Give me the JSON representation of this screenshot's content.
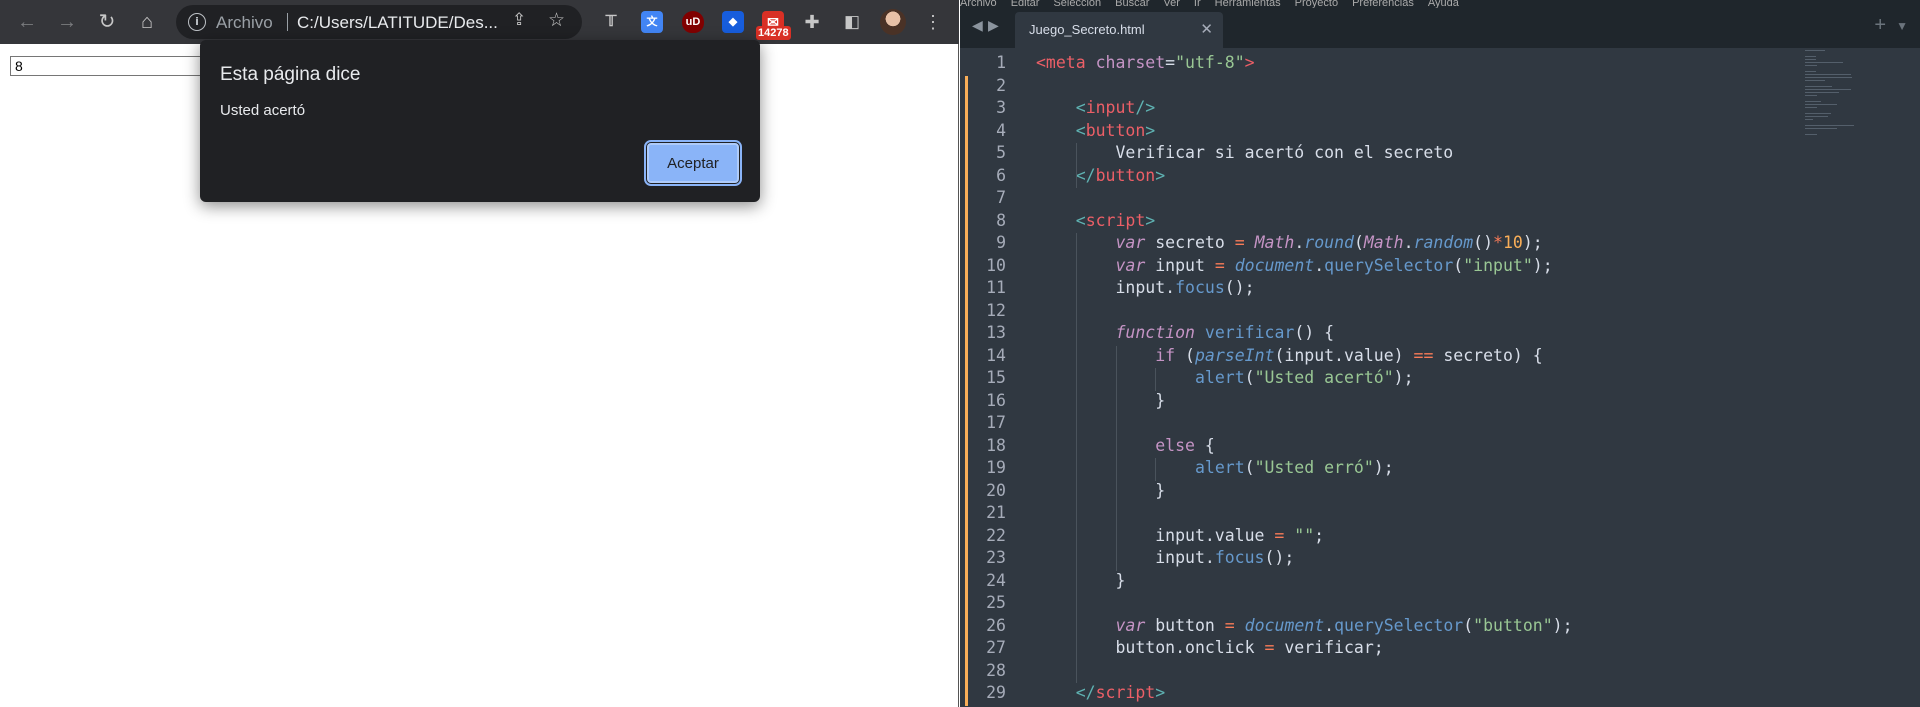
{
  "browser": {
    "omnibox": {
      "scheme_label": "Archivo",
      "url": "C:/Users/LATITUDE/Des..."
    },
    "extensions": [
      {
        "name": "translate-extension-icon",
        "glyph": "文"
      },
      {
        "name": "ublock-icon",
        "glyph": "uD"
      },
      {
        "name": "bitwarden-icon",
        "glyph": "◆"
      },
      {
        "name": "gmail-checker-icon",
        "glyph": "✉"
      }
    ],
    "mail_badge": "14278",
    "page": {
      "input_value": "8"
    },
    "alert": {
      "title": "Esta página dice",
      "message": "Usted acertó",
      "ok_label": "Aceptar"
    }
  },
  "editor": {
    "menu": [
      "Archivo",
      "Editar",
      "Selección",
      "Buscar",
      "Ver",
      "Ir",
      "Herramientas",
      "Proyecto",
      "Preferencias",
      "Ayuda"
    ],
    "tab_name": "Juego_Secreto.html",
    "modified_lines": [
      2,
      3,
      4,
      5,
      6,
      7,
      8,
      9,
      10,
      11,
      12,
      13,
      14,
      15,
      16,
      17,
      18,
      19,
      20,
      21,
      22,
      23,
      24,
      25,
      26,
      27,
      28,
      29
    ],
    "lines": [
      {
        "n": "1",
        "tokens": [
          [
            "t-tag",
            "<meta"
          ],
          [
            "t-plain",
            " "
          ],
          [
            "t-attr",
            "charset"
          ],
          [
            "t-plain",
            "="
          ],
          [
            "t-str",
            "\"utf-8\""
          ],
          [
            "t-tag",
            ">"
          ]
        ]
      },
      {
        "n": "2",
        "tokens": []
      },
      {
        "n": "3",
        "tokens": [
          [
            "t-plain",
            "    "
          ],
          [
            "t-punc",
            "<"
          ],
          [
            "t-tag",
            "input"
          ],
          [
            "t-punc",
            "/>"
          ]
        ]
      },
      {
        "n": "4",
        "tokens": [
          [
            "t-plain",
            "    "
          ],
          [
            "t-punc",
            "<"
          ],
          [
            "t-tag",
            "button"
          ],
          [
            "t-punc",
            ">"
          ]
        ]
      },
      {
        "n": "5",
        "tokens": [
          [
            "t-plain",
            "        Verificar si acertó con el secreto"
          ]
        ]
      },
      {
        "n": "6",
        "tokens": [
          [
            "t-plain",
            "    "
          ],
          [
            "t-punc",
            "</"
          ],
          [
            "t-tag",
            "button"
          ],
          [
            "t-punc",
            ">"
          ]
        ]
      },
      {
        "n": "7",
        "tokens": []
      },
      {
        "n": "8",
        "tokens": [
          [
            "t-plain",
            "    "
          ],
          [
            "t-punc",
            "<"
          ],
          [
            "t-tag",
            "script"
          ],
          [
            "t-punc",
            ">"
          ]
        ]
      },
      {
        "n": "9",
        "tokens": [
          [
            "t-plain",
            "        "
          ],
          [
            "t-kw",
            "var"
          ],
          [
            "t-plain",
            " secreto "
          ],
          [
            "t-op",
            "="
          ],
          [
            "t-plain",
            " "
          ],
          [
            "t-obj",
            "Math"
          ],
          [
            "t-plain",
            "."
          ],
          [
            "t-fni",
            "round"
          ],
          [
            "t-plain",
            "("
          ],
          [
            "t-obj",
            "Math"
          ],
          [
            "t-plain",
            "."
          ],
          [
            "t-fni",
            "random"
          ],
          [
            "t-plain",
            "()"
          ],
          [
            "t-op",
            "*"
          ],
          [
            "t-num",
            "10"
          ],
          [
            "t-plain",
            ");"
          ]
        ]
      },
      {
        "n": "10",
        "tokens": [
          [
            "t-plain",
            "        "
          ],
          [
            "t-kw",
            "var"
          ],
          [
            "t-plain",
            " input "
          ],
          [
            "t-op",
            "="
          ],
          [
            "t-plain",
            " "
          ],
          [
            "t-fni",
            "document"
          ],
          [
            "t-plain",
            "."
          ],
          [
            "t-fn",
            "querySelector"
          ],
          [
            "t-plain",
            "("
          ],
          [
            "t-str",
            "\"input\""
          ],
          [
            "t-plain",
            ");"
          ]
        ]
      },
      {
        "n": "11",
        "tokens": [
          [
            "t-plain",
            "        input."
          ],
          [
            "t-fn",
            "focus"
          ],
          [
            "t-plain",
            "();"
          ]
        ]
      },
      {
        "n": "12",
        "tokens": []
      },
      {
        "n": "13",
        "tokens": [
          [
            "t-plain",
            "        "
          ],
          [
            "t-kw",
            "function"
          ],
          [
            "t-plain",
            " "
          ],
          [
            "t-fn",
            "verificar"
          ],
          [
            "t-plain",
            "() {"
          ]
        ]
      },
      {
        "n": "14",
        "tokens": [
          [
            "t-plain",
            "            "
          ],
          [
            "t-kwn",
            "if"
          ],
          [
            "t-plain",
            " ("
          ],
          [
            "t-fni",
            "parseInt"
          ],
          [
            "t-plain",
            "(input.value) "
          ],
          [
            "t-op",
            "=="
          ],
          [
            "t-plain",
            " secreto) {"
          ]
        ]
      },
      {
        "n": "15",
        "tokens": [
          [
            "t-plain",
            "                "
          ],
          [
            "t-fn",
            "alert"
          ],
          [
            "t-plain",
            "("
          ],
          [
            "t-str",
            "\"Usted acertó\""
          ],
          [
            "t-plain",
            ");"
          ]
        ]
      },
      {
        "n": "16",
        "tokens": [
          [
            "t-plain",
            "            }"
          ]
        ]
      },
      {
        "n": "17",
        "tokens": []
      },
      {
        "n": "18",
        "tokens": [
          [
            "t-plain",
            "            "
          ],
          [
            "t-kwn",
            "else"
          ],
          [
            "t-plain",
            " {"
          ]
        ]
      },
      {
        "n": "19",
        "tokens": [
          [
            "t-plain",
            "                "
          ],
          [
            "t-fn",
            "alert"
          ],
          [
            "t-plain",
            "("
          ],
          [
            "t-str",
            "\"Usted erró\""
          ],
          [
            "t-plain",
            ");"
          ]
        ]
      },
      {
        "n": "20",
        "tokens": [
          [
            "t-plain",
            "            }"
          ]
        ]
      },
      {
        "n": "21",
        "tokens": []
      },
      {
        "n": "22",
        "tokens": [
          [
            "t-plain",
            "            input.value "
          ],
          [
            "t-op",
            "="
          ],
          [
            "t-plain",
            " "
          ],
          [
            "t-str",
            "\"\""
          ],
          [
            "t-plain",
            ";"
          ]
        ]
      },
      {
        "n": "23",
        "tokens": [
          [
            "t-plain",
            "            input."
          ],
          [
            "t-fn",
            "focus"
          ],
          [
            "t-plain",
            "();"
          ]
        ]
      },
      {
        "n": "24",
        "tokens": [
          [
            "t-plain",
            "        }"
          ]
        ]
      },
      {
        "n": "25",
        "tokens": []
      },
      {
        "n": "26",
        "tokens": [
          [
            "t-plain",
            "        "
          ],
          [
            "t-kw",
            "var"
          ],
          [
            "t-plain",
            " button "
          ],
          [
            "t-op",
            "="
          ],
          [
            "t-plain",
            " "
          ],
          [
            "t-fni",
            "document"
          ],
          [
            "t-plain",
            "."
          ],
          [
            "t-fn",
            "querySelector"
          ],
          [
            "t-plain",
            "("
          ],
          [
            "t-str",
            "\"button\""
          ],
          [
            "t-plain",
            ");"
          ]
        ]
      },
      {
        "n": "27",
        "tokens": [
          [
            "t-plain",
            "        button.onclick "
          ],
          [
            "t-op",
            "="
          ],
          [
            "t-plain",
            " verificar;"
          ]
        ]
      },
      {
        "n": "28",
        "tokens": []
      },
      {
        "n": "29",
        "tokens": [
          [
            "t-plain",
            "    "
          ],
          [
            "t-punc",
            "</"
          ],
          [
            "t-tag",
            "script"
          ],
          [
            "t-punc",
            ">"
          ]
        ]
      }
    ]
  }
}
